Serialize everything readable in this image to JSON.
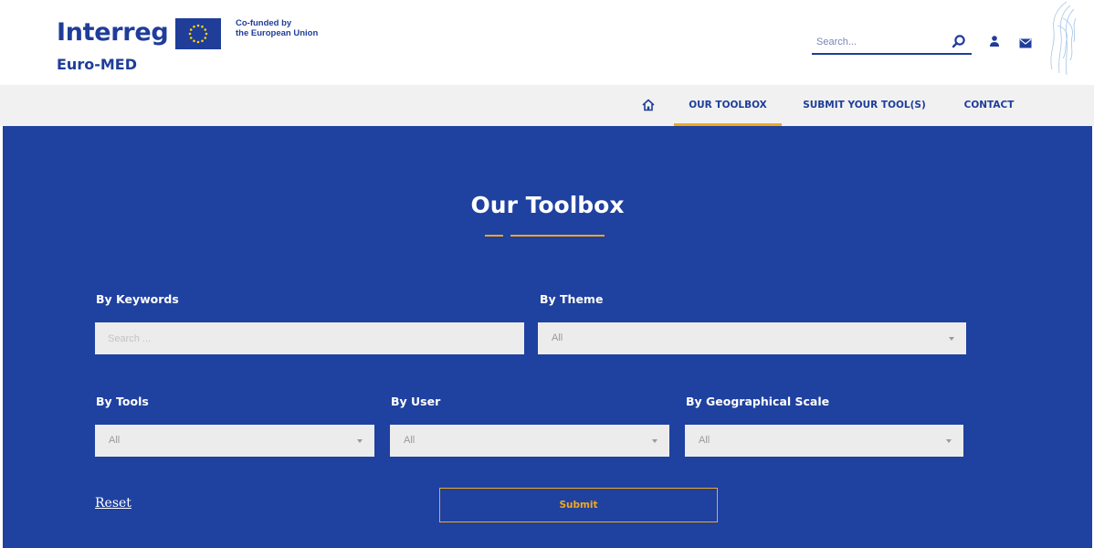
{
  "brand": {
    "name": "Interreg",
    "region": "Euro-MED",
    "cofunded_line1": "Co-funded by",
    "cofunded_line2": "the European Union"
  },
  "header": {
    "search_placeholder": "Search...",
    "icons": [
      "search-icon",
      "user-icon",
      "mail-icon"
    ]
  },
  "nav": {
    "home_icon": "home-icon",
    "items": [
      {
        "label": "OUR TOOLBOX",
        "active": true
      },
      {
        "label": "SUBMIT YOUR TOOL(S)",
        "active": false
      },
      {
        "label": "CONTACT",
        "active": false
      }
    ]
  },
  "main": {
    "title": "Our Toolbox",
    "filters": {
      "keywords": {
        "label": "By Keywords",
        "placeholder": "Search ..."
      },
      "theme": {
        "label": "By Theme",
        "value": "All"
      },
      "tools": {
        "label": "By Tools",
        "value": "All"
      },
      "user": {
        "label": "By User",
        "value": "All"
      },
      "geo": {
        "label": "By Geographical Scale",
        "value": "All"
      }
    },
    "reset_label": "Reset",
    "submit_label": "Submit"
  },
  "colors": {
    "brand_blue": "#1f3d99",
    "section_blue": "#1f41a0",
    "accent_orange": "#f2a81d",
    "nav_background": "#f1f1f1",
    "field_background": "#ececec"
  }
}
